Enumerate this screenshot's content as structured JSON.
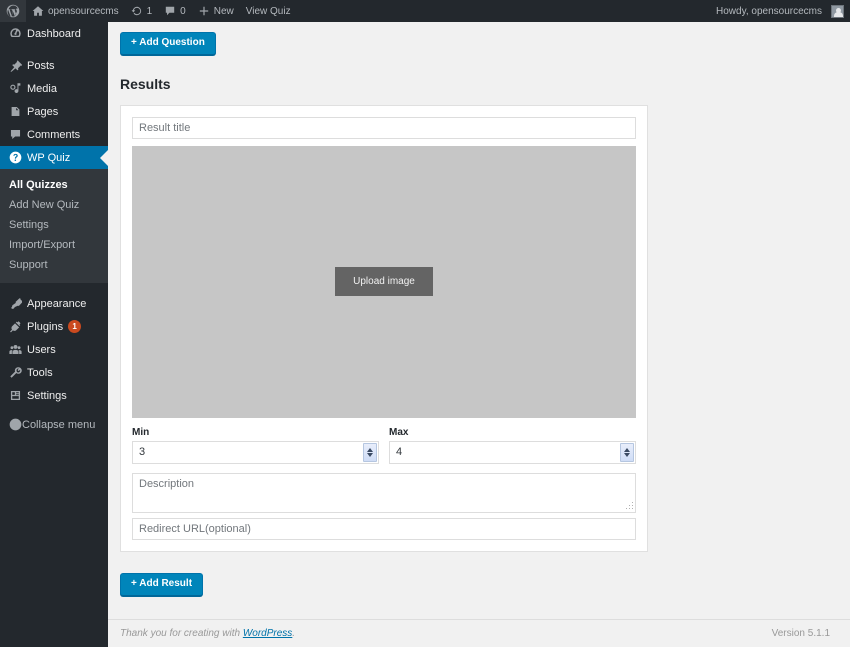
{
  "adminbar": {
    "wp_logo": "wordpress-logo-icon",
    "site_name": "opensourcecms",
    "updates_count": "1",
    "comments_count": "0",
    "new_label": "New",
    "view_quiz_label": "View Quiz",
    "howdy": "Howdy, opensourcecms"
  },
  "sidebar": {
    "items": [
      {
        "label": "Dashboard",
        "icon": "dashboard-icon",
        "current": false
      },
      {
        "label": "Posts",
        "icon": "posts-pin-icon",
        "current": false
      },
      {
        "label": "Media",
        "icon": "media-icon",
        "current": false
      },
      {
        "label": "Pages",
        "icon": "pages-icon",
        "current": false
      },
      {
        "label": "Comments",
        "icon": "comments-icon",
        "current": false
      },
      {
        "label": "WP Quiz",
        "icon": "question-mark-icon",
        "current": true
      },
      {
        "label": "Appearance",
        "icon": "paintbrush-icon",
        "current": false
      },
      {
        "label": "Plugins",
        "icon": "plugin-plug-icon",
        "current": false,
        "badge": "1"
      },
      {
        "label": "Users",
        "icon": "users-icon",
        "current": false
      },
      {
        "label": "Tools",
        "icon": "wrench-icon",
        "current": false
      },
      {
        "label": "Settings",
        "icon": "settings-sliders-icon",
        "current": false
      }
    ],
    "submenu": [
      {
        "label": "All Quizzes",
        "current": true
      },
      {
        "label": "Add New Quiz",
        "current": false
      },
      {
        "label": "Settings",
        "current": false
      },
      {
        "label": "Import/Export",
        "current": false
      },
      {
        "label": "Support",
        "current": false
      }
    ],
    "collapse_label": "Collapse menu",
    "collapse_icon": "collapse-arrow-icon"
  },
  "main": {
    "add_question_label": "+ Add Question",
    "results_heading": "Results",
    "result": {
      "title_placeholder": "Result title",
      "title_value": "",
      "upload_image_label": "Upload image",
      "min_label": "Min",
      "min_value": "3",
      "max_label": "Max",
      "max_value": "4",
      "description_placeholder": "Description",
      "description_value": "",
      "redirect_placeholder": "Redirect URL(optional)",
      "redirect_value": ""
    },
    "add_result_label": "+ Add Result"
  },
  "footer": {
    "thanks_prefix": "Thank you for creating with ",
    "wordpress_link": "WordPress",
    "thanks_suffix": ".",
    "version": "Version 5.1.1"
  },
  "colors": {
    "accent_blue": "#0085ba",
    "sidebar_bg": "#23282d",
    "submenu_bg": "#32373c",
    "current_blue": "#0073aa",
    "badge_orange": "#ca4a1f",
    "image_placeholder": "#c6c6c6",
    "upload_button": "#646464"
  }
}
